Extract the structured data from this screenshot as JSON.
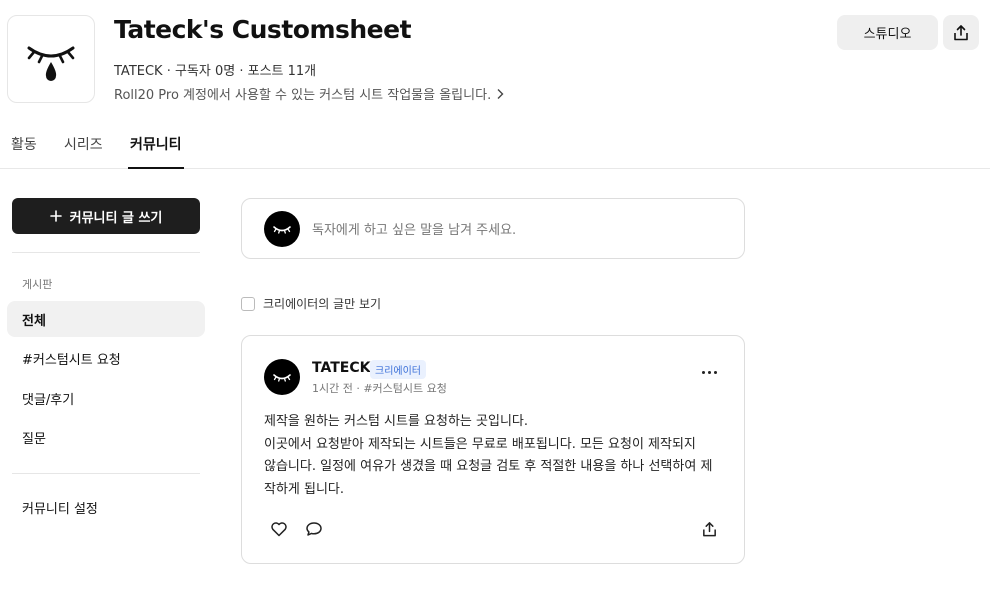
{
  "header": {
    "title": "Tateck's Customsheet",
    "meta": "TATECK · 구독자 0명 · 포스트 11개",
    "description": "Roll20 Pro 계정에서 사용할 수 있는 커스텀 시트 작업물을 올립니다.",
    "studio_label": "스튜디오",
    "share_icon": "share-icon",
    "logo_icon": "closed-eye-teardrop-icon"
  },
  "tabs": [
    {
      "label": "활동",
      "active": false
    },
    {
      "label": "시리즈",
      "active": false
    },
    {
      "label": "커뮤니티",
      "active": true
    }
  ],
  "sidebar": {
    "write_label": "커뮤니티 글 쓰기",
    "board_heading": "게시판",
    "items": [
      {
        "label": "전체",
        "active": true
      },
      {
        "label": "#커스텀시트 요청",
        "active": false
      },
      {
        "label": "댓글/후기",
        "active": false
      },
      {
        "label": "질문",
        "active": false
      }
    ],
    "settings_label": "커뮤니티 설정"
  },
  "composer": {
    "placeholder": "독자에게 하고 싶은 말을 남겨 주세요."
  },
  "filter": {
    "label": "크리에이터의 글만 보기",
    "checked": false
  },
  "post": {
    "author": "TATECK",
    "badge": "크리에이터",
    "meta": "1시간 전 · #커스텀시트 요청",
    "body_lines": [
      "제작을 원하는 커스텀 시트를 요청하는 곳입니다.",
      "이곳에서 요청받아 제작되는 시트들은 무료로 배포됩니다. 모든 요청이 제작되지",
      "않습니다. 일정에 여유가 생겼을 때 요청글 검토 후 적절한 내용을 하나 선택하여 제",
      "작하게 됩니다."
    ]
  },
  "colors": {
    "accent_dark": "#1e1e1e",
    "badge_text": "#3a6fd8",
    "badge_bg": "#eaf1fe",
    "border": "#dddddd"
  }
}
